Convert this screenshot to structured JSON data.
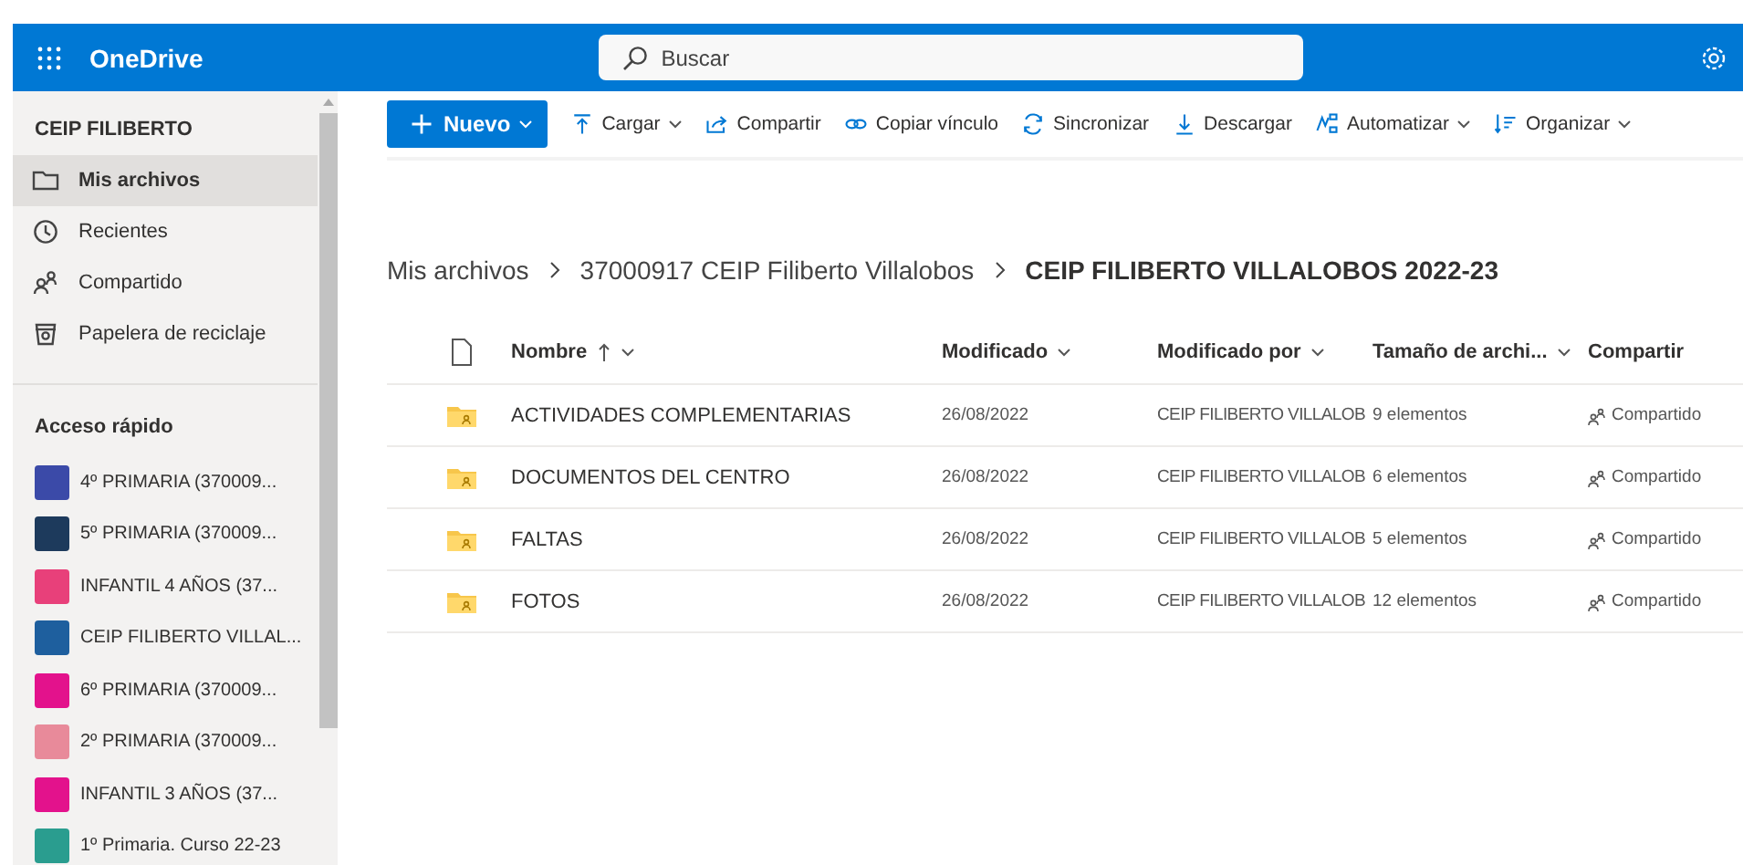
{
  "header": {
    "app_name": "OneDrive",
    "search": {
      "placeholder": "Buscar"
    }
  },
  "sidebar": {
    "account": "CEIP FILIBERTO",
    "nav_items": [
      {
        "label": "Mis archivos",
        "selected": true
      },
      {
        "label": "Recientes",
        "selected": false
      },
      {
        "label": "Compartido",
        "selected": false
      },
      {
        "label": "Papelera de reciclaje",
        "selected": false
      }
    ],
    "quick_access_title": "Acceso rápido",
    "quick_access": [
      {
        "label": "4º PRIMARIA (370009...",
        "color": "#3b4aa8"
      },
      {
        "label": "5º PRIMARIA (370009...",
        "color": "#1d3a5c"
      },
      {
        "label": "INFANTIL 4 AÑOS (37...",
        "color": "#e8407a"
      },
      {
        "label": "CEIP FILIBERTO VILLAL...",
        "color": "#1e5f9e"
      },
      {
        "label": "6º PRIMARIA (370009...",
        "color": "#e3128c"
      },
      {
        "label": "2º PRIMARIA (370009...",
        "color": "#e88a9a"
      },
      {
        "label": "INFANTIL 3 AÑOS (37...",
        "color": "#e3128c"
      },
      {
        "label": "1º Primaria. Curso 22-23",
        "color": "#2a9d8f"
      }
    ]
  },
  "toolbar": [
    {
      "label": "Nuevo",
      "kind": "primary",
      "dropdown": true
    },
    {
      "label": "Cargar",
      "kind": "command",
      "dropdown": true
    },
    {
      "label": "Compartir",
      "kind": "command",
      "dropdown": false
    },
    {
      "label": "Copiar vínculo",
      "kind": "command",
      "dropdown": false
    },
    {
      "label": "Sincronizar",
      "kind": "command",
      "dropdown": false
    },
    {
      "label": "Descargar",
      "kind": "command",
      "dropdown": false
    },
    {
      "label": "Automatizar",
      "kind": "command",
      "dropdown": true
    },
    {
      "label": "Organizar",
      "kind": "command",
      "dropdown": true
    }
  ],
  "breadcrumb": [
    "Mis archivos",
    "37000917 CEIP Filiberto Villalobos",
    "CEIP FILIBERTO VILLALOBOS 2022-23"
  ],
  "table": {
    "columns": [
      {
        "label": "Nombre",
        "sorted": true,
        "dropdown": true
      },
      {
        "label": "Modificado",
        "sorted": false,
        "dropdown": true
      },
      {
        "label": "Modificado por",
        "sorted": false,
        "dropdown": true
      },
      {
        "label": "Tamaño de archi...",
        "sorted": false,
        "dropdown": true
      },
      {
        "label": "Compartir",
        "sorted": false,
        "dropdown": false
      }
    ],
    "rows": [
      {
        "name": "ACTIVIDADES COMPLEMENTARIAS",
        "modified": "26/08/2022",
        "modified_by": "CEIP FILIBERTO VILLALOB",
        "size": "9 elementos",
        "sharing": "Compartido"
      },
      {
        "name": "DOCUMENTOS DEL CENTRO",
        "modified": "26/08/2022",
        "modified_by": "CEIP FILIBERTO VILLALOB",
        "size": "6 elementos",
        "sharing": "Compartido"
      },
      {
        "name": "FALTAS",
        "modified": "26/08/2022",
        "modified_by": "CEIP FILIBERTO VILLALOB",
        "size": "5 elementos",
        "sharing": "Compartido"
      },
      {
        "name": "FOTOS",
        "modified": "26/08/2022",
        "modified_by": "CEIP FILIBERTO VILLALOB",
        "size": "12 elementos",
        "sharing": "Compartido"
      }
    ]
  }
}
